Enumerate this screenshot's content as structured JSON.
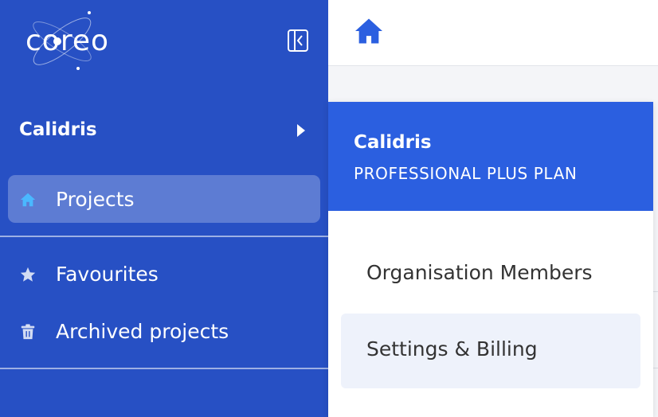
{
  "app": {
    "logo_text": "coreo"
  },
  "sidebar": {
    "org_name": "Calidris",
    "items": [
      {
        "label": "Projects",
        "icon": "home-icon",
        "active": true
      },
      {
        "label": "Favourites",
        "icon": "star-icon",
        "active": false
      },
      {
        "label": "Archived projects",
        "icon": "trash-icon",
        "active": false
      }
    ]
  },
  "dropdown": {
    "org_name": "Calidris",
    "plan": "PROFESSIONAL PLUS PLAN",
    "items": [
      {
        "label": "Organisation Members"
      },
      {
        "label": "Settings & Billing"
      }
    ]
  },
  "colors": {
    "sidebar_bg": "#2750c4",
    "dropdown_header_bg": "#2b5fe0",
    "accent_icon": "#4ab8ff"
  }
}
